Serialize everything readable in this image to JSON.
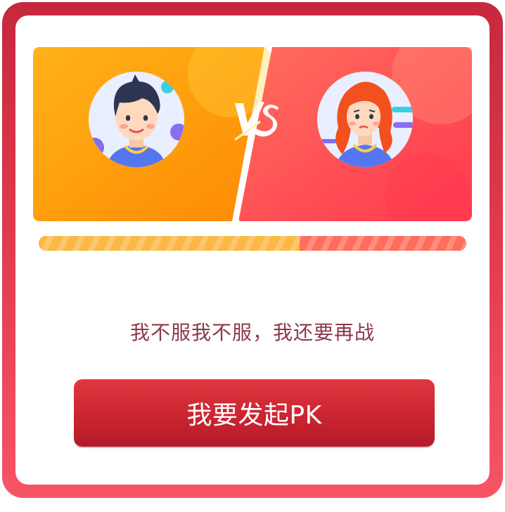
{
  "battle": {
    "left_player": {
      "avatar": "boy-avatar-icon",
      "side_color": "#ffa10a"
    },
    "right_player": {
      "avatar": "girl-avatar-icon",
      "side_color": "#ff4b55"
    },
    "vs_mark": "VS",
    "progress": {
      "left_fraction": 0.61,
      "left_color": "#fbb843",
      "right_color": "#ff6d5c"
    }
  },
  "message": {
    "text": "我不服我不服，我还要再战"
  },
  "action": {
    "button_label": "我要发起PK",
    "button_color": "#cb2531"
  },
  "theme": {
    "frame_color": "#e23c4e",
    "text_color": "#8b3a4a"
  }
}
